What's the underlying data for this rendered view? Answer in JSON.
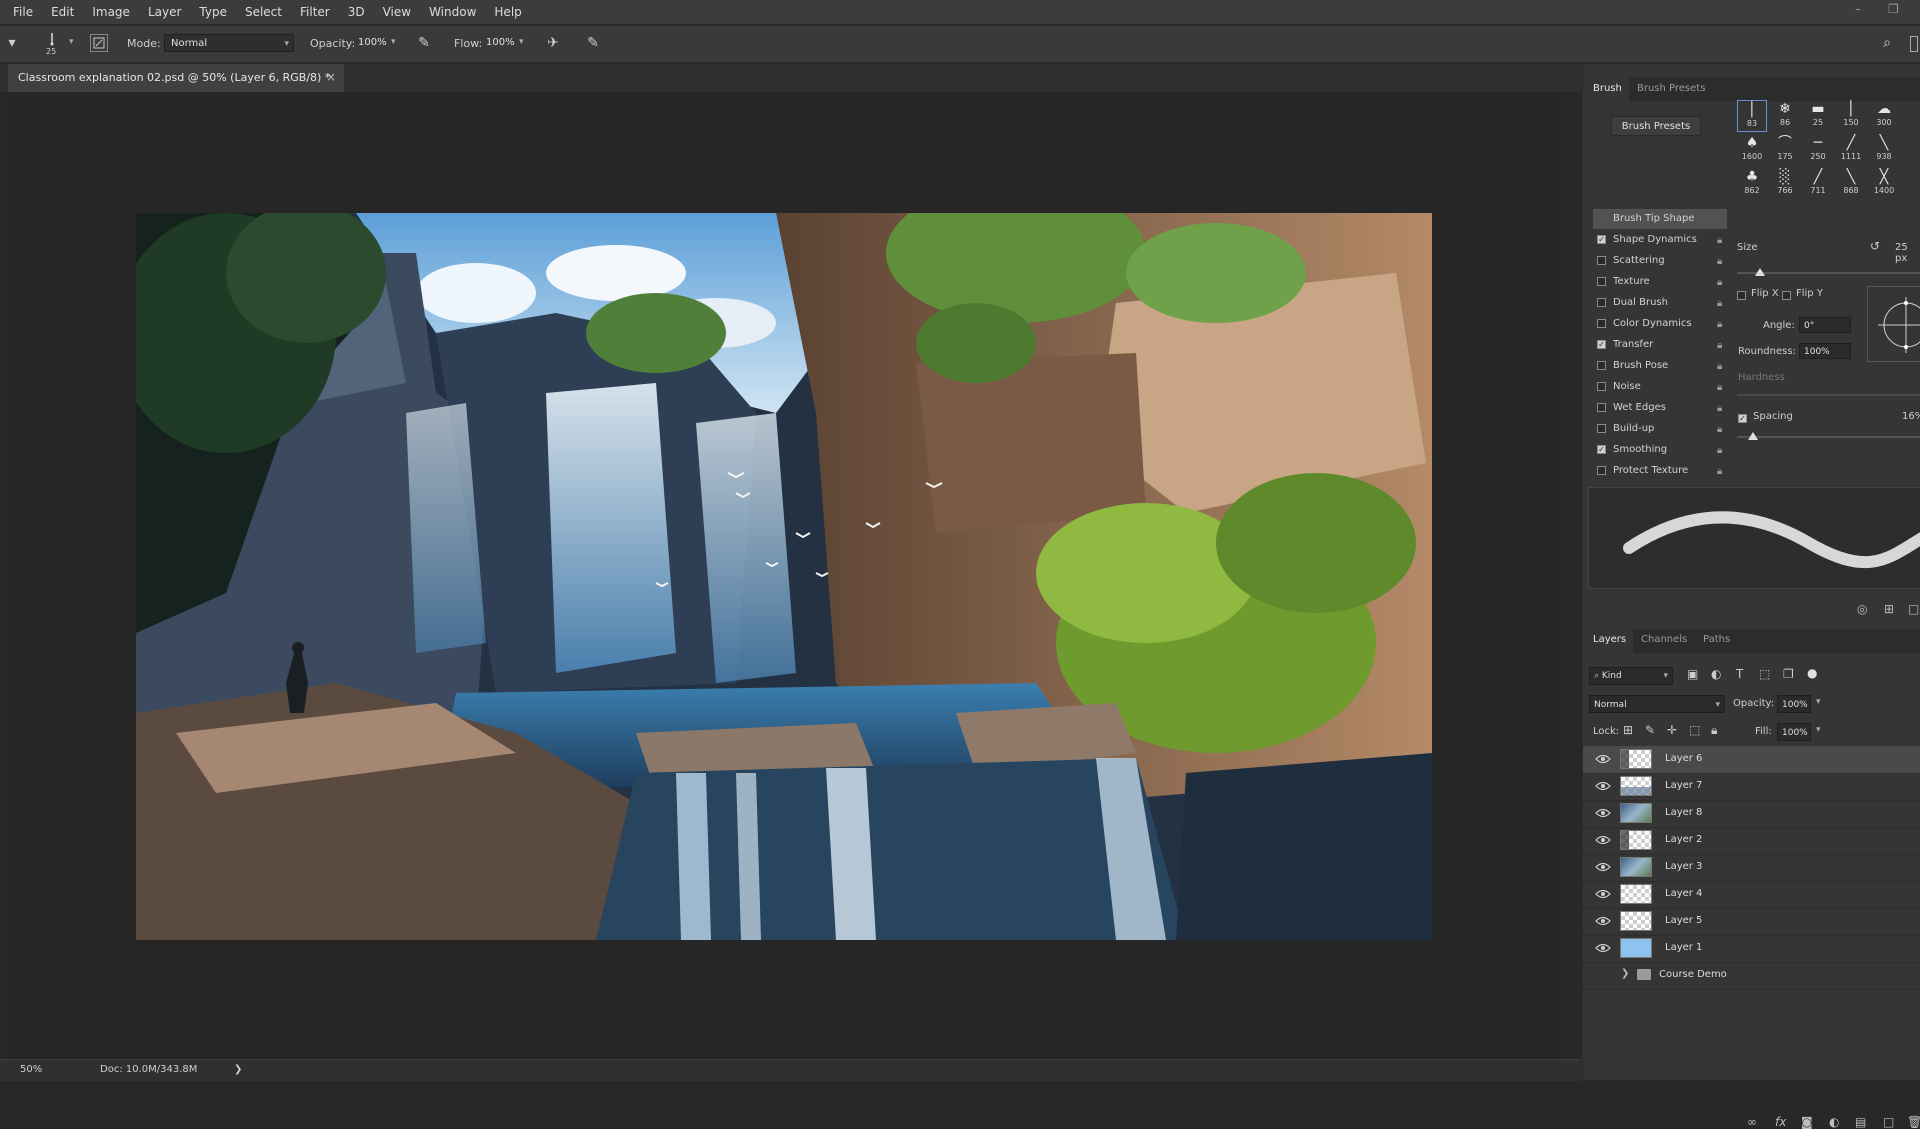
{
  "menu": [
    "File",
    "Edit",
    "Image",
    "Layer",
    "Type",
    "Select",
    "Filter",
    "3D",
    "View",
    "Window",
    "Help"
  ],
  "window_buttons": {
    "minimize": "–",
    "restore": "❐"
  },
  "options": {
    "brush_size": "25",
    "mode_label": "Mode:",
    "mode_value": "Normal",
    "opacity_label": "Opacity:",
    "opacity_value": "100%",
    "flow_label": "Flow:",
    "flow_value": "100%"
  },
  "document": {
    "tab_title": "Classroom explanation 02.psd @ 50% (Layer 6, RGB/8) *",
    "close": "×"
  },
  "status": {
    "zoom": "50%",
    "doc_info": "Doc: 10.0M/343.8M",
    "arrow": "❯"
  },
  "brush_panel": {
    "tabs": [
      "Brush",
      "Brush Presets"
    ],
    "presets_button": "Brush Presets",
    "items": [
      {
        "label": "Brush Tip Shape",
        "checkbox": false,
        "checked": false,
        "selected": true
      },
      {
        "label": "Shape Dynamics",
        "checkbox": true,
        "checked": true
      },
      {
        "label": "Scattering",
        "checkbox": true,
        "checked": false
      },
      {
        "label": "Texture",
        "checkbox": true,
        "checked": false
      },
      {
        "label": "Dual Brush",
        "checkbox": true,
        "checked": false
      },
      {
        "label": "Color Dynamics",
        "checkbox": true,
        "checked": false
      },
      {
        "label": "Transfer",
        "checkbox": true,
        "checked": true
      },
      {
        "label": "Brush Pose",
        "checkbox": true,
        "checked": false
      },
      {
        "label": "Noise",
        "checkbox": true,
        "checked": false
      },
      {
        "label": "Wet Edges",
        "checkbox": true,
        "checked": false
      },
      {
        "label": "Build-up",
        "checkbox": true,
        "checked": false
      },
      {
        "label": "Smoothing",
        "checkbox": true,
        "checked": true
      },
      {
        "label": "Protect Texture",
        "checkbox": true,
        "checked": false
      }
    ],
    "tips": [
      [
        "83",
        "86",
        "25",
        "150",
        "300"
      ],
      [
        "1600",
        "175",
        "250",
        "1111",
        "938"
      ],
      [
        "862",
        "766",
        "711",
        "868",
        "1400"
      ]
    ],
    "size_label": "Size",
    "size_value": "25 px",
    "flip_x": "Flip X",
    "flip_y": "Flip Y",
    "angle_label": "Angle:",
    "angle_value": "0°",
    "roundness_label": "Roundness:",
    "roundness_value": "100%",
    "hardness_label": "Hardness",
    "spacing_label": "Spacing",
    "spacing_value": "16%"
  },
  "layers_panel": {
    "tabs": [
      "Layers",
      "Channels",
      "Paths"
    ],
    "filter_label": "Kind",
    "blend_mode": "Normal",
    "opacity_label": "Opacity:",
    "opacity_value": "100%",
    "lock_label": "Lock:",
    "fill_label": "Fill:",
    "fill_value": "100%",
    "layers": [
      {
        "name": "Layer 6",
        "selected": true,
        "thumb": "checker-dark"
      },
      {
        "name": "Layer 7",
        "thumb": "checker-scene"
      },
      {
        "name": "Layer 8",
        "thumb": "scene"
      },
      {
        "name": "Layer 2",
        "thumb": "checker-dark"
      },
      {
        "name": "Layer 3",
        "thumb": "scene"
      },
      {
        "name": "Layer 4",
        "thumb": "checker"
      },
      {
        "name": "Layer 5",
        "thumb": "checker"
      },
      {
        "name": "Layer 1",
        "thumb": "blue"
      }
    ],
    "group_name": "Course Demo"
  },
  "colors": {
    "menubar": "#3c3c3c",
    "panel": "#353535",
    "canvas_bg": "#262626",
    "selected_layer": "#4a4a4a",
    "layer1_fill": "#8ec3f0"
  }
}
